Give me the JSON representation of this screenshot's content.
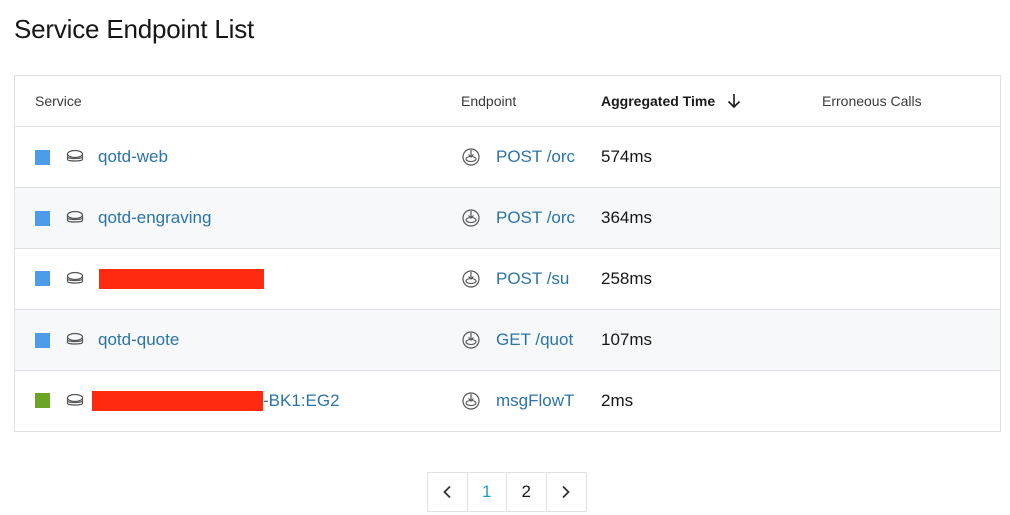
{
  "title": "Service Endpoint List",
  "columns": {
    "service": "Service",
    "endpoint": "Endpoint",
    "time": "Aggregated Time",
    "errors": "Erroneous Calls"
  },
  "colors": {
    "blue_swatch": "#4c9be8",
    "green_swatch": "#6aa526",
    "link": "#2a74a8",
    "redaction": "#ff2a0f"
  },
  "rows": [
    {
      "service": "qotd-web",
      "endpoint": "POST /orc",
      "time": "574ms",
      "errors": ""
    },
    {
      "service": "qotd-engraving",
      "endpoint": "POST /orc",
      "time": "364ms",
      "errors": ""
    },
    {
      "service": "",
      "endpoint": "POST /su",
      "time": "258ms",
      "errors": ""
    },
    {
      "service": "qotd-quote",
      "endpoint": "GET /quot",
      "time": "107ms",
      "errors": ""
    },
    {
      "service": "-BK1:EG2",
      "endpoint": "msgFlowT",
      "time": "2ms",
      "errors": ""
    }
  ],
  "pagination": {
    "pages": [
      "1",
      "2"
    ],
    "current": "1"
  }
}
